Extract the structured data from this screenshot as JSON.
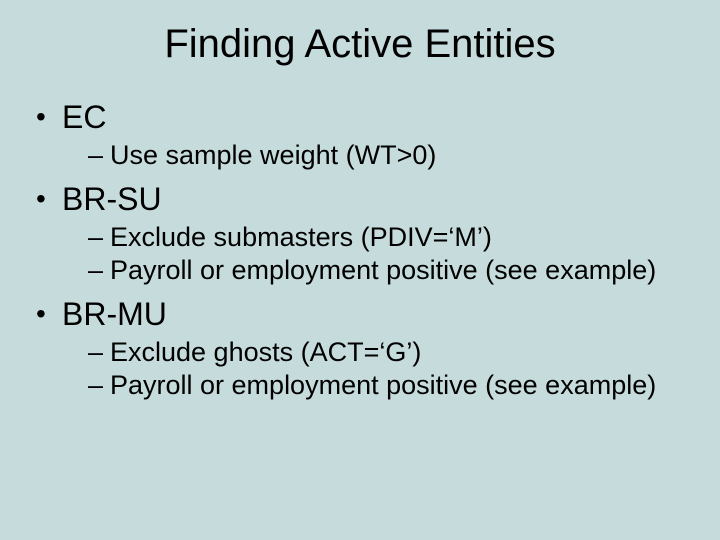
{
  "title": "Finding Active Entities",
  "bullets": [
    {
      "label": "EC",
      "sub": [
        "Use sample weight (WT>0)"
      ]
    },
    {
      "label": "BR-SU",
      "sub": [
        "Exclude submasters (PDIV=‘M’)",
        "Payroll or employment positive (see example)"
      ]
    },
    {
      "label": "BR-MU",
      "sub": [
        "Exclude ghosts (ACT=‘G’)",
        "Payroll or employment positive (see example)"
      ]
    }
  ]
}
